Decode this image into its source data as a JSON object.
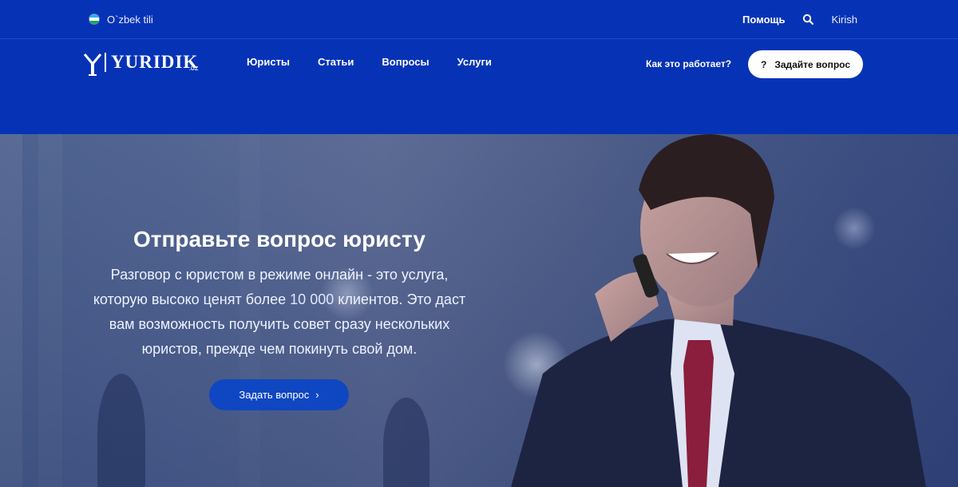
{
  "topbar": {
    "language": "O`zbek tili",
    "help": "Помощь",
    "login": "Kirish"
  },
  "logo": {
    "text": "YURIDIK",
    "suffix": ".UZ"
  },
  "nav": {
    "items": [
      "Юристы",
      "Статьи",
      "Вопросы",
      "Услуги"
    ],
    "how_it_works": "Как это работает?",
    "ask_button": "Задайте вопрос",
    "ask_icon": "?"
  },
  "hero": {
    "title": "Отправьте вопрос юристу",
    "desc_part1": "Разговор с юристом в режиме онлайн - это услуга, которую высоко ценят более ",
    "desc_highlight": "10 000",
    "desc_part2": " клиентов. Это даст вам возможность получить совет сразу нескольких юристов, прежде чем покинуть свой дом.",
    "button": "Задать вопрос",
    "button_icon": "›"
  },
  "colors": {
    "header_bg": "#0633b6",
    "button_blue": "#0f47c2",
    "text_white": "#ffffff"
  },
  "icons": {
    "flag": "uzbekistan-flag-icon",
    "search": "search-icon",
    "chevron": "chevron-right-icon"
  }
}
